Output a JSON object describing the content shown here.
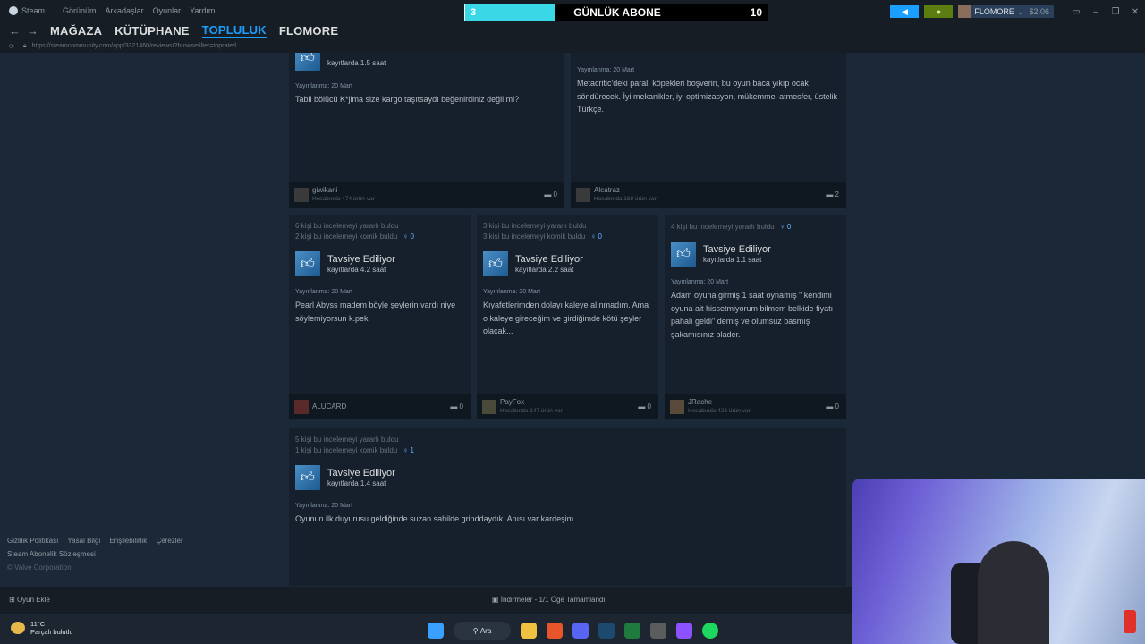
{
  "menu": {
    "items": [
      "Steam",
      "Görünüm",
      "Arkadaşlar",
      "Oyunlar",
      "Yardım"
    ]
  },
  "sub_widget": {
    "left": "3",
    "title": "GÜNLÜK ABONE",
    "right": "10"
  },
  "user": {
    "name": "FLOMORE",
    "wallet": "$2.06"
  },
  "nav": {
    "tabs": [
      "MAĞAZA",
      "KÜTÜPHANE",
      "TOPLULUK",
      "FLOMORE"
    ],
    "active": "TOPLULUK"
  },
  "url": "https://steamcommunity.com/app/3321460/reviews/?browsefilter=toprated",
  "reviews": [
    {
      "hours": "kayıtlarda 1.5 saat",
      "posted": "Yayınlanma: 20 Mart",
      "body": "Tabii bölücü K*jima size kargo taşıtsaydı beğenirdiniz değil mi?",
      "author": "giwikani",
      "author_sub": "Hesabında 474 ürün var",
      "comments": "0"
    },
    {
      "posted": "Yayınlanma: 20 Mart",
      "body": "Metacritic'deki paralı köpekleri boşverin, bu oyun baca yıkıp ocak söndürecek. İyi mekanikler, iyi optimizasyon, mükemmel atmosfer, üstelik Türkçe.",
      "author": "Alcatraz",
      "author_sub": "Hesabında 168 ürün var",
      "comments": "2"
    },
    {
      "helpful": "6 kişi bu incelemeyi yararlı buldu",
      "funny": "2 kişi bu incelemeyi komik buldu",
      "awards": "0",
      "rec": "Tavsiye Ediliyor",
      "hours": "kayıtlarda 4.2 saat",
      "posted": "Yayınlanma: 20 Mart",
      "body": "Pearl Abyss madem böyle şeylerin vardı niye söylemiyorsun k.pek",
      "author": "ALUCARD",
      "author_sub": "",
      "comments": "0"
    },
    {
      "helpful": "3 kişi bu incelemeyi yararlı buldu",
      "funny": "3 kişi bu incelemeyi komik buldu",
      "awards": "0",
      "rec": "Tavsiye Ediliyor",
      "hours": "kayıtlarda 2.2 saat",
      "posted": "Yayınlanma: 20 Mart",
      "body": "Kıyafetlerimden dolayı kaleye alınmadım. Ama o kaleye gireceğim ve girdiğimde kötü şeyler olacak...",
      "author": "PayFox",
      "author_sub": "Hesabında 147 ürün var",
      "comments": "0"
    },
    {
      "helpful": "4 kişi bu incelemeyi yararlı buldu",
      "awards": "0",
      "rec": "Tavsiye Ediliyor",
      "hours": "kayıtlarda 1.1 saat",
      "posted": "Yayınlanma: 20 Mart",
      "body": "Adam oyuna girmiş 1 saat oynamış \" kendimi oyuna ait hissetmiyorum bilmem belkide fiyatı pahalı geldi\" demiş ve olumsuz basmış şakamısınız blader.",
      "author": "JRache",
      "author_sub": "Hesabında 426 ürün var",
      "comments": "0"
    },
    {
      "helpful": "5 kişi bu incelemeyi yararlı buldu",
      "funny": "1 kişi bu incelemeyi komik buldu",
      "awards": "1",
      "rec": "Tavsiye Ediliyor",
      "hours": "kayıtlarda 1.4 saat",
      "posted": "Yayınlanma: 20 Mart",
      "body": "Oyunun ilk duyurusu geldiğinde suzan sahilde grinddaydık. Anısı var kardeşim."
    }
  ],
  "footer_links": {
    "row1": [
      "Gizlilik Politikası",
      "Yasal Bilgi",
      "Erişilebilirlik",
      "Çerezler"
    ],
    "row2": "Steam Abonelik Sözleşmesi",
    "row3": "© Valve Corporation."
  },
  "bottombar": {
    "add_game": "Oyun Ekle",
    "downloads": "İndirmeler - 1/1 Öğe Tamamlandı"
  },
  "taskbar": {
    "temp": "11°C",
    "weather": "Parçalı bulutlu",
    "search": "Ara"
  }
}
